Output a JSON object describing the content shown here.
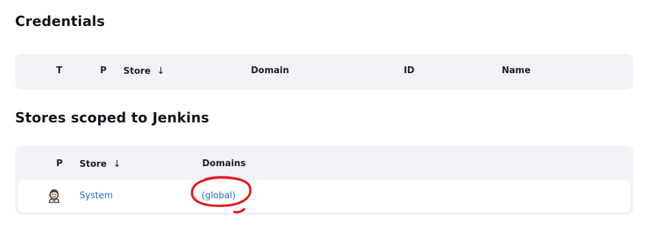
{
  "credentials": {
    "title": "Credentials",
    "columns": {
      "t": "T",
      "p": "P",
      "store": "Store",
      "store_sort": "↓",
      "domain": "Domain",
      "id": "ID",
      "name": "Name"
    }
  },
  "stores": {
    "title": "Stores scoped to Jenkins",
    "columns": {
      "p": "P",
      "store": "Store",
      "store_sort": "↓",
      "domains": "Domains"
    },
    "rows": [
      {
        "icon": "jenkins-icon",
        "store": "System",
        "domain": "(global)"
      }
    ]
  },
  "annotation_color": "#e01b1b",
  "link_color": "#1f6fc5"
}
